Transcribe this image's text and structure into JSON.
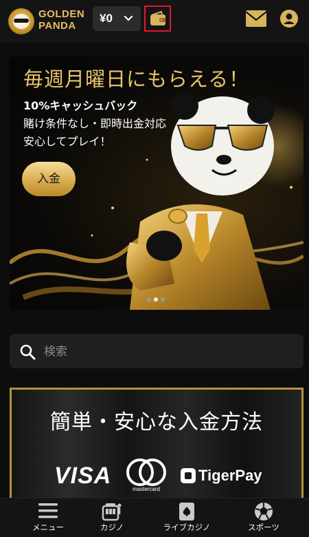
{
  "header": {
    "logo_line1": "GOLDEN",
    "logo_line2": "PANDA",
    "balance": "¥0",
    "icons": {
      "balance_dropdown": "chevron-down-icon",
      "wallet": "wallet-icon",
      "mail": "mail-icon",
      "account": "account-icon"
    },
    "brand_color": "#e6bf63",
    "highlight_color": "#e0182c"
  },
  "banner": {
    "title": "毎週月曜日にもらえる！",
    "line1": "10%キャッシュバック",
    "line2": "賭け条件なし・即時出金対応",
    "line3": "安心してプレイ！",
    "cta_label": "入金",
    "slide_count": 3,
    "active_slide": 2
  },
  "search": {
    "placeholder": "検索",
    "value": ""
  },
  "payment": {
    "title": "簡単・安心な入金方法",
    "methods": [
      "VISA",
      "mastercard",
      "TigerPay"
    ]
  },
  "bottom_nav": [
    {
      "label": "メニュー",
      "icon": "menu-icon"
    },
    {
      "label": "カジノ",
      "icon": "slot-machine-icon"
    },
    {
      "label": "ライブカジノ",
      "icon": "playing-card-icon"
    },
    {
      "label": "スポーツ",
      "icon": "soccer-ball-icon"
    }
  ]
}
